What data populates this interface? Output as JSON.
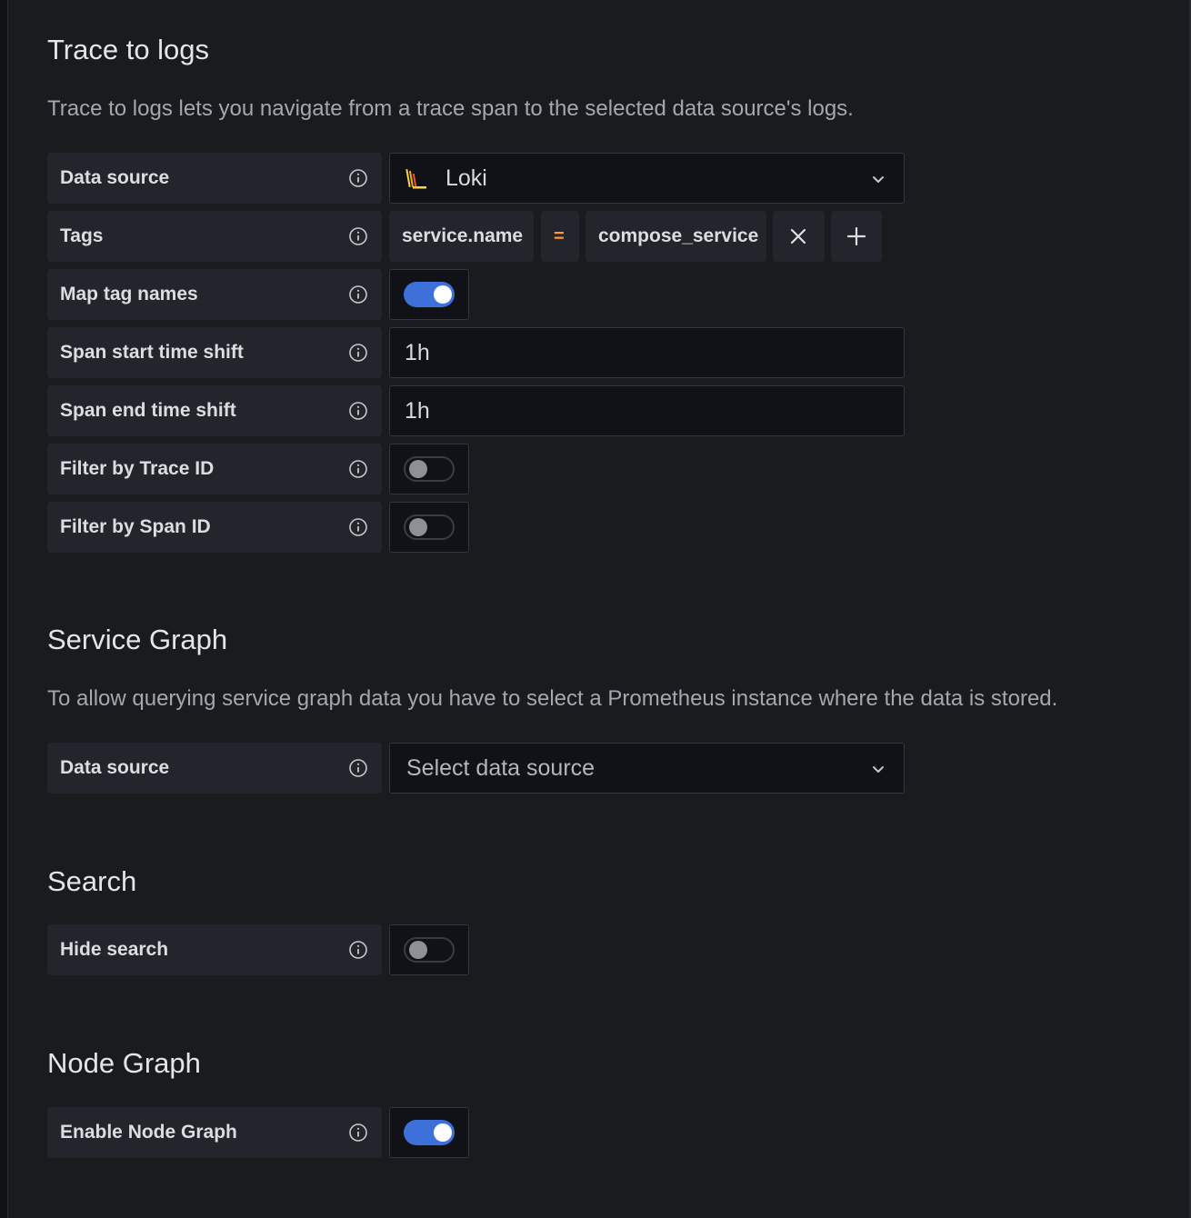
{
  "trace_to_logs": {
    "title": "Trace to logs",
    "description": "Trace to logs lets you navigate from a trace span to the selected data source's logs.",
    "data_source": {
      "label": "Data source",
      "value": "Loki",
      "icon": "loki-logo-icon"
    },
    "tags": {
      "label": "Tags",
      "key": "service.name",
      "operator": "=",
      "value": "compose_service"
    },
    "map_tag_names": {
      "label": "Map tag names",
      "enabled": true
    },
    "span_start_time_shift": {
      "label": "Span start time shift",
      "value": "1h"
    },
    "span_end_time_shift": {
      "label": "Span end time shift",
      "value": "1h"
    },
    "filter_by_trace_id": {
      "label": "Filter by Trace ID",
      "enabled": false
    },
    "filter_by_span_id": {
      "label": "Filter by Span ID",
      "enabled": false
    }
  },
  "service_graph": {
    "title": "Service Graph",
    "description": "To allow querying service graph data you have to select a Prometheus instance where the data is stored.",
    "data_source": {
      "label": "Data source",
      "placeholder": "Select data source"
    }
  },
  "search": {
    "title": "Search",
    "hide_search": {
      "label": "Hide search",
      "enabled": false
    }
  },
  "node_graph": {
    "title": "Node Graph",
    "enable_node_graph": {
      "label": "Enable Node Graph",
      "enabled": true
    }
  },
  "colors": {
    "background": "#1a1b1f",
    "label_bg": "#22252b",
    "input_bg": "#111217",
    "toggle_on": "#3d71d9",
    "operator": "#ff9830"
  }
}
